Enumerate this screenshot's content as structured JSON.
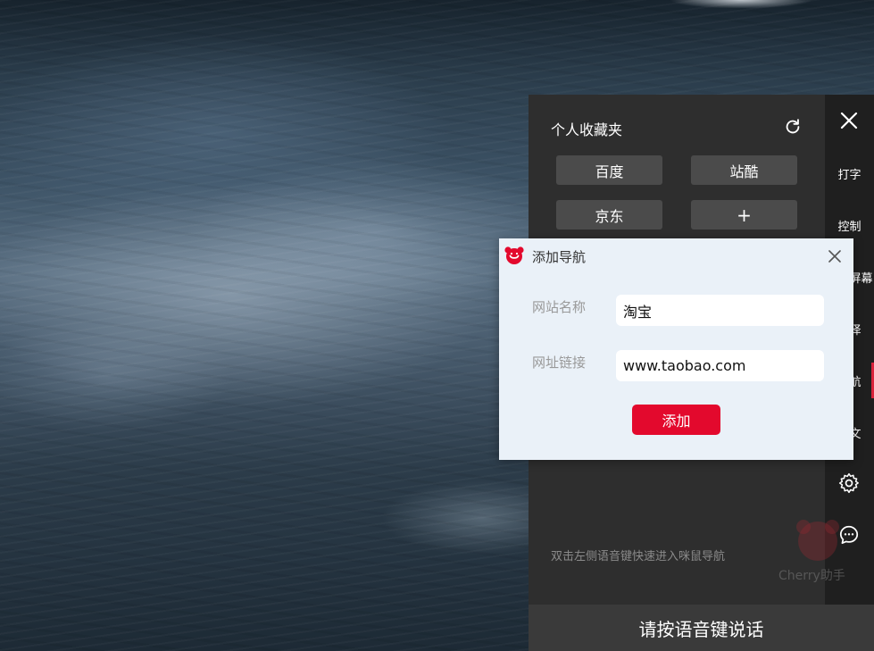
{
  "panel": {
    "title": "个人收藏夹",
    "favorites": [
      "百度",
      "站酷",
      "京东"
    ],
    "add_label": "+",
    "hint": "双击左侧语音键快速进入咪鼠导航"
  },
  "sidebar": {
    "items": [
      {
        "label": "打字"
      },
      {
        "label": "控制"
      },
      {
        "label": "语音屏幕"
      },
      {
        "label": "翻译"
      },
      {
        "label": "导航"
      },
      {
        "label": "中文"
      }
    ],
    "watermark": "Cherry助手"
  },
  "voice_bar": {
    "label": "请按语音键说话"
  },
  "dialog": {
    "title": "添加导航",
    "name_label": "网站名称",
    "name_value": "淘宝",
    "url_label": "网址链接",
    "url_value": "www.taobao.com",
    "add_label": "添加"
  },
  "colors": {
    "accent": "#e3092d",
    "panel_bg": "#2e2e2e",
    "sidebar_bg": "#1f1f1f",
    "dialog_bg": "#eaf1f8"
  },
  "icons": [
    "refresh-icon",
    "close-icon",
    "settings-gear-icon",
    "chat-bubble-icon",
    "mouse-logo-icon"
  ]
}
